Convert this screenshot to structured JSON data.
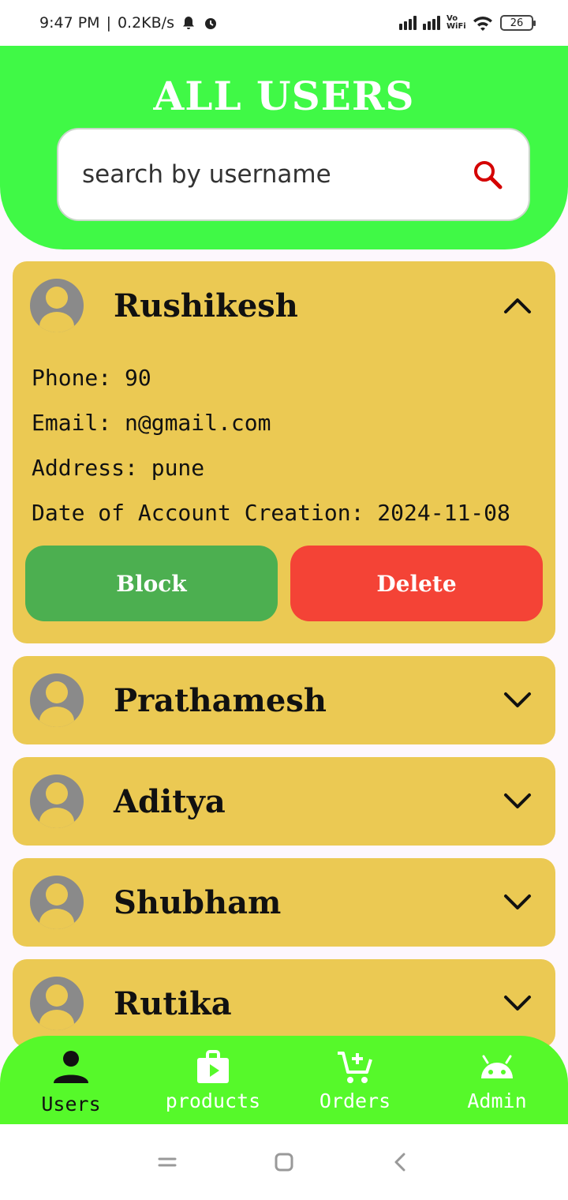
{
  "status_bar": {
    "time": "9:47 PM",
    "net_speed": "0.2KB/s",
    "wifi_label": "Vo WiFi",
    "battery": "26"
  },
  "header": {
    "title": "ALL USERS",
    "search_placeholder": "search by username"
  },
  "users": [
    {
      "name": "Rushikesh",
      "expanded": true,
      "phone": "Phone: 90",
      "email": "Email: n@gmail.com",
      "address": "Address: pune",
      "created": "Date of Account Creation: 2024-11-08",
      "block_label": "Block",
      "delete_label": "Delete"
    },
    {
      "name": "Prathamesh",
      "expanded": false
    },
    {
      "name": "Aditya",
      "expanded": false
    },
    {
      "name": "Shubham",
      "expanded": false
    },
    {
      "name": "Rutika",
      "expanded": false
    }
  ],
  "bottom_nav": [
    {
      "label": "Users",
      "icon": "person-icon",
      "active": true
    },
    {
      "label": "products",
      "icon": "play-bag-icon",
      "active": false
    },
    {
      "label": "Orders",
      "icon": "cart-add-icon",
      "active": false
    },
    {
      "label": "Admin",
      "icon": "android-icon",
      "active": false
    }
  ],
  "colors": {
    "header_green": "#40f946",
    "card_yellow": "#ebc953",
    "block_green": "#4caf50",
    "delete_red": "#f44336",
    "nav_green": "#56f92a"
  }
}
